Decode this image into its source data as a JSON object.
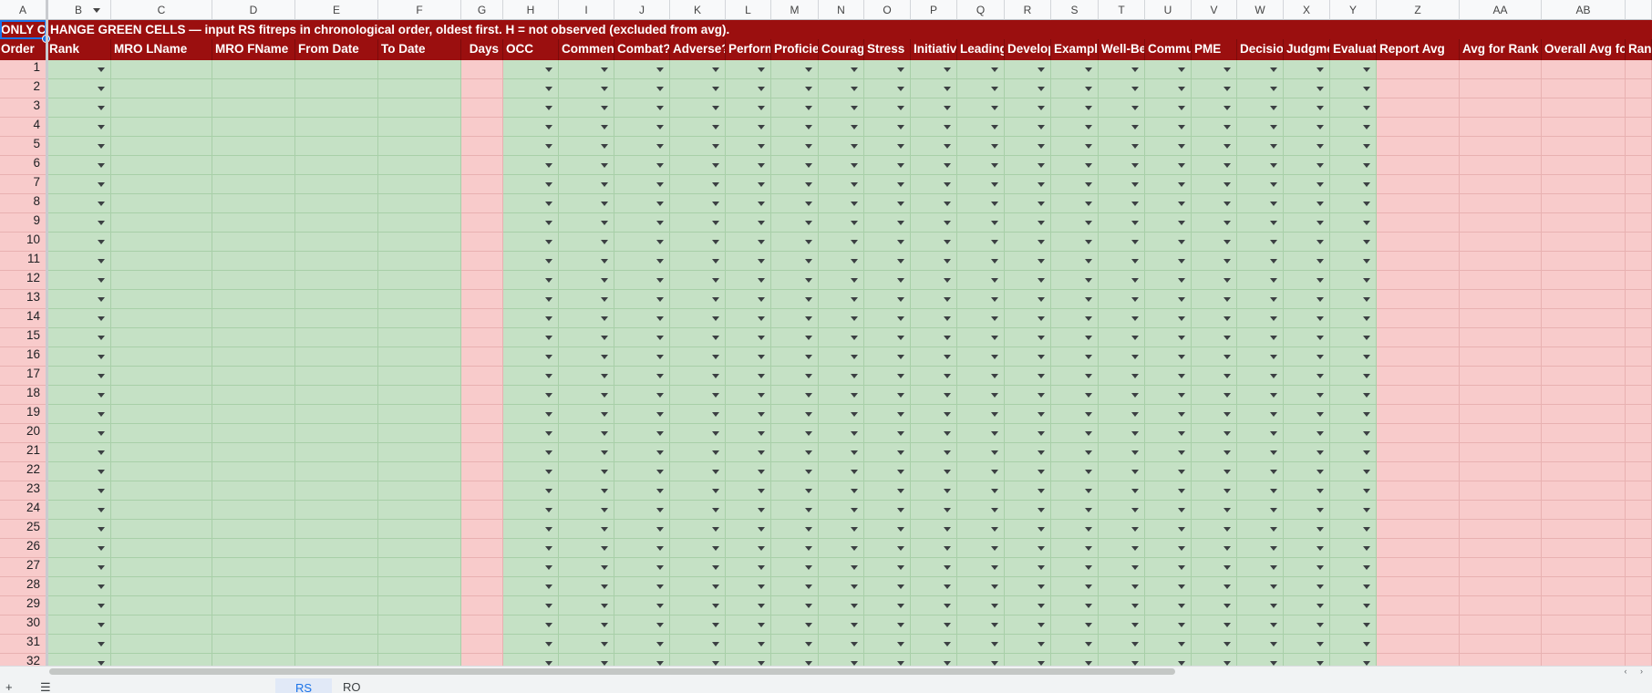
{
  "columns": [
    "A",
    "B",
    "C",
    "D",
    "E",
    "F",
    "G",
    "H",
    "I",
    "J",
    "K",
    "L",
    "M",
    "N",
    "O",
    "P",
    "Q",
    "R",
    "S",
    "T",
    "U",
    "V",
    "W",
    "X",
    "Y",
    "Z",
    "AA",
    "AB"
  ],
  "instruction_prefix": "ONLY C",
  "instruction_text": "HANGE GREEN CELLS — input RS fitreps in chronological order, oldest first. H = not observed (excluded from avg).",
  "headers": [
    "Order",
    "Rank",
    "MRO LName",
    "MRO FName",
    "From Date",
    "To Date",
    "Days",
    "OCC",
    "Commen",
    "Combat?",
    "Adverse?",
    "Perform",
    "Proficie",
    "Courag",
    "Stress",
    "Initiativ",
    "Leading",
    "Develop",
    "Exampl",
    "Well-Be",
    "Commu",
    "PME",
    "Decisio",
    "Judgme",
    "Evaluat",
    "Report Avg",
    "Avg for Rank",
    "Overall Avg fo",
    "Ran"
  ],
  "row_numbers": [
    1,
    2,
    3,
    4,
    5,
    6,
    7,
    8,
    9,
    10,
    11,
    12,
    13,
    14,
    15,
    16,
    17,
    18,
    19,
    20,
    21,
    22,
    23,
    24,
    25,
    26,
    27,
    28,
    29,
    30,
    31,
    32
  ],
  "tabs": [
    "",
    "",
    "",
    "",
    "",
    "RS",
    "RO"
  ],
  "colors": {
    "header_red": "#9b0f0f",
    "input_green": "#c5e1c5",
    "calc_pink": "#f8cbcb",
    "selection_blue": "#1a73e8"
  }
}
